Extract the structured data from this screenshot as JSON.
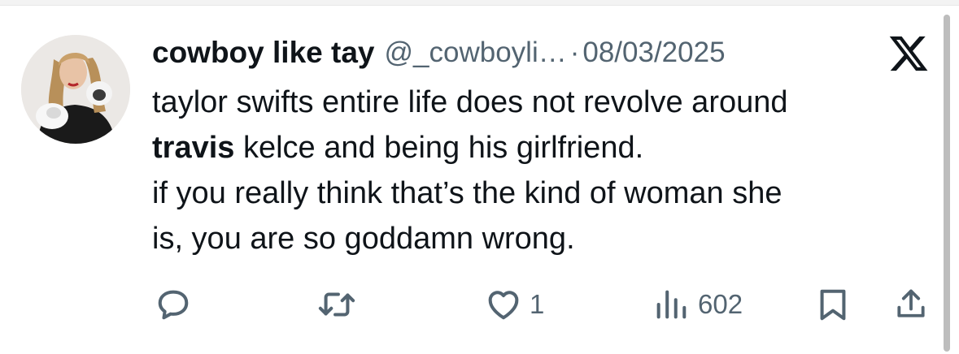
{
  "tweet": {
    "author_name": "cowboy like tay",
    "handle": "@_cowboyli…",
    "separator": "·",
    "date": "08/03/2025",
    "text_lines": [
      {
        "bold": "",
        "rest": "taylor swifts entire life does not revolve around"
      },
      {
        "bold": "travis",
        "rest": " kelce and being his girlfriend."
      },
      {
        "bold": "",
        "rest": "if you really think that’s the kind of woman she"
      },
      {
        "bold": "",
        "rest": "is, you are so goddamn wrong."
      }
    ]
  },
  "actions": {
    "reply_count": "",
    "retweet_count": "",
    "like_count": "1",
    "views_count": "602"
  },
  "icons": {
    "logo": "x-logo-icon",
    "reply": "reply-icon",
    "retweet": "retweet-icon",
    "like": "heart-icon",
    "views": "views-icon",
    "bookmark": "bookmark-icon",
    "share": "share-icon"
  },
  "colors": {
    "text": "#0f1419",
    "muted": "#536471",
    "icon": "#536471"
  }
}
